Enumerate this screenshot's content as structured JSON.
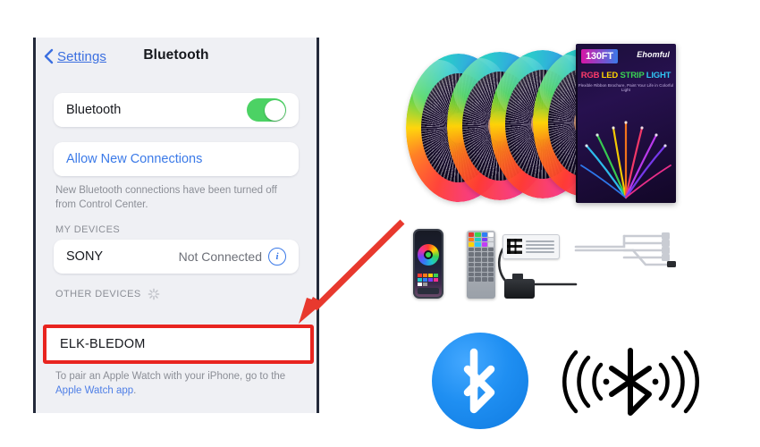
{
  "settings_panel": {
    "nav": {
      "back_label": "Settings",
      "title": "Bluetooth",
      "back_icon": "chevron-left-icon"
    },
    "bluetooth_row": {
      "label": "Bluetooth",
      "toggle_state": "on",
      "toggle_color": "#4CD264"
    },
    "allow_new_connections": {
      "label": "Allow New Connections",
      "link_color": "#3b7ae8"
    },
    "helper_text": "New Bluetooth connections have been turned off from Control Center.",
    "my_devices": {
      "header": "MY DEVICES",
      "devices": [
        {
          "name": "SONY",
          "status": "Not Connected",
          "info_icon": "info-circle-icon"
        }
      ]
    },
    "other_devices": {
      "header": "OTHER DEVICES",
      "spinner_icon": "activity-spinner-icon",
      "devices": [
        {
          "name": "ELK-BLEDOM",
          "highlighted": true
        }
      ],
      "highlight_color": "#e8241f"
    },
    "footer_text_prefix": "To pair an Apple Watch with your iPhone, go to the ",
    "footer_link": "Apple Watch app",
    "footer_text_suffix": "."
  },
  "annotation": {
    "arrow_icon": "red-arrow-icon",
    "arrow_color": "#e8392e"
  },
  "product": {
    "box": {
      "length_badge": "130FT",
      "brand": "Ehomful",
      "title_parts": [
        "RGB",
        " LED",
        " STRIP",
        " LIGHT"
      ],
      "subtitle": "Flexible Ribbon Brochure, Paint Your Life in Colorful Light"
    },
    "reels_count": 4,
    "accessories": [
      {
        "name": "smartphone-app",
        "label": "phone-with-rgb-app-icon"
      },
      {
        "name": "ir-remote",
        "label": "44-key-remote-icon"
      },
      {
        "name": "controller-box",
        "label": "bluetooth-controller-icon"
      },
      {
        "name": "power-adapter",
        "label": "power-adapter-icon"
      },
      {
        "name": "splitter-cable",
        "label": "4-way-splitter-icon"
      }
    ]
  },
  "bluetooth_logos": {
    "circle_logo": {
      "name": "bluetooth-circle-logo",
      "color": "#1f8ff2"
    },
    "signal_logo": {
      "name": "bluetooth-signal-icon",
      "color": "#000000"
    }
  }
}
